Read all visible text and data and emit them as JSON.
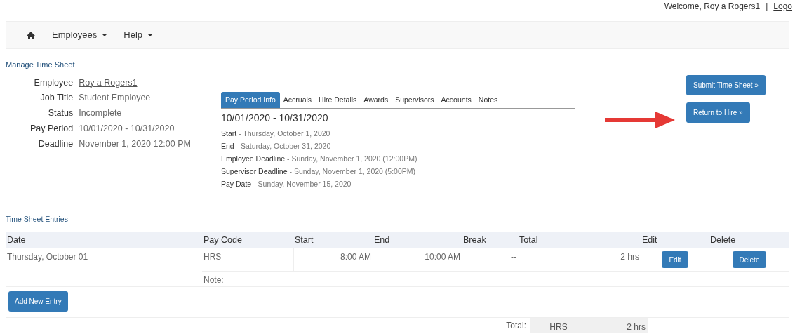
{
  "header": {
    "welcome": "Welcome, Roy a Rogers1",
    "separator": "|",
    "logout": "Logo"
  },
  "nav": {
    "items": [
      {
        "label": "Employees"
      },
      {
        "label": "Help"
      }
    ]
  },
  "page_title": "Manage Time Sheet",
  "details": [
    {
      "label": "Employee",
      "value": "Roy a Rogers1",
      "kind": "link"
    },
    {
      "label": "Job Title",
      "value": "Student Employee",
      "kind": "text"
    },
    {
      "label": "Status",
      "value": "Incomplete",
      "kind": "text"
    },
    {
      "label": "Pay Period",
      "value": "10/01/2020 - 10/31/2020",
      "kind": "text"
    },
    {
      "label": "Deadline",
      "value": "November 1, 2020 12:00 PM",
      "kind": "text"
    }
  ],
  "tabs": [
    {
      "label": "Pay Period Info",
      "selected": true
    },
    {
      "label": "Accruals",
      "selected": false
    },
    {
      "label": "Hire Details",
      "selected": false
    },
    {
      "label": "Awards",
      "selected": false
    },
    {
      "label": "Supervisors",
      "selected": false
    },
    {
      "label": "Accounts",
      "selected": false
    },
    {
      "label": "Notes",
      "selected": false
    }
  ],
  "period": {
    "title": "10/01/2020 - 10/31/2020",
    "lines": [
      {
        "label": "Start",
        "value": "- Thursday, October 1, 2020"
      },
      {
        "label": "End",
        "value": "- Saturday, October 31, 2020"
      },
      {
        "label": "Employee Deadline",
        "value": "- Sunday, November 1, 2020 (12:00PM)"
      },
      {
        "label": "Supervisor Deadline",
        "value": "- Sunday, November 1, 2020 (5:00PM)"
      },
      {
        "label": "Pay Date",
        "value": "- Sunday, November 15, 2020"
      }
    ]
  },
  "actions": [
    "Submit Time Sheet »",
    "Return to Hire »"
  ],
  "entries_title": "Time Sheet Entries",
  "table": {
    "columns": [
      "Date",
      "Pay Code",
      "Start",
      "End",
      "Break",
      "Total",
      "Edit",
      "Delete"
    ],
    "rows": [
      {
        "date": "Thursday, October 01",
        "pay_code": "HRS",
        "start": "8:00 AM",
        "end": "10:00 AM",
        "break": "--",
        "total": "2 hrs",
        "edit": "Edit",
        "delete": "Delete",
        "note_label": "Note:"
      }
    ]
  },
  "add_button": "Add New Entry",
  "totals": {
    "label": "Total:",
    "code": "HRS",
    "hours": "2 hrs"
  }
}
